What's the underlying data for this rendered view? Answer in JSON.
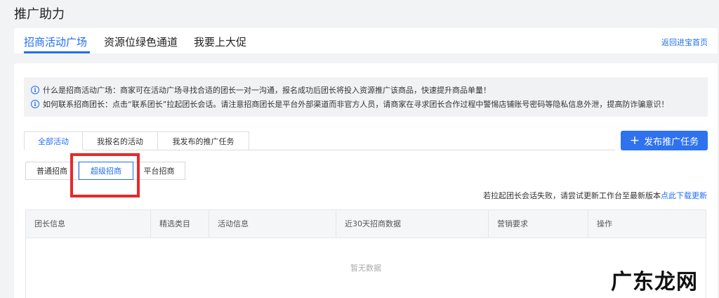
{
  "page": {
    "title": "推广助力"
  },
  "topnav": {
    "tabs": [
      {
        "label": "招商活动广场",
        "active": true
      },
      {
        "label": "资源位绿色通道",
        "active": false
      },
      {
        "label": "我要上大促",
        "active": false
      }
    ],
    "back_link": "返回进宝首页"
  },
  "notice": {
    "rows": [
      {
        "icon": "info-icon",
        "text": "什么是招商活动广场：商家可在活动广场寻找合适的团长一对一沟通，报名成功后团长将投入资源推广该商品，快速提升商品单量！"
      },
      {
        "icon": "info-icon",
        "text": "如何联系招商团长：点击“联系团长”拉起团长会话。请注意招商团长是平台外部渠道而非官方人员，请商家在寻求团长合作过程中警惕店铺账号密码等隐私信息外泄，提高防诈骗意识！"
      }
    ]
  },
  "subtabs": [
    {
      "label": "全部活动",
      "active": true
    },
    {
      "label": "我报名的活动",
      "active": false
    },
    {
      "label": "我发布的推广任务",
      "active": false
    }
  ],
  "publish_button": {
    "icon": "plus-icon",
    "label": "发布推广任务"
  },
  "type_filter": [
    {
      "label": "普通招商",
      "active": false
    },
    {
      "label": "超级招商",
      "active": true
    },
    {
      "label": "平台招商",
      "active": false
    }
  ],
  "hint": {
    "text": "若拉起团长会话失败，请尝试更新工作台至最新版本",
    "link": "点此下载更新"
  },
  "table": {
    "columns": [
      "团长信息",
      "精选类目",
      "活动信息",
      "近30天招商数据",
      "营销要求",
      "操作"
    ],
    "empty_text": "暂无数据"
  },
  "watermark": "广东龙网",
  "colors": {
    "primary": "#1f6ff0",
    "highlight": "#e8282b"
  }
}
